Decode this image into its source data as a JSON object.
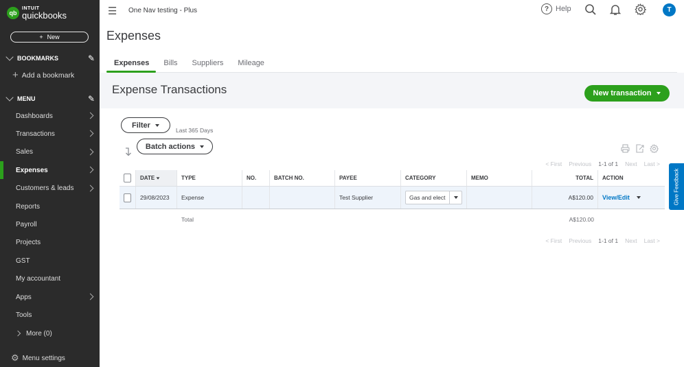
{
  "sidebar": {
    "logo": {
      "mark": "qb",
      "brand_top": "INTUIT",
      "brand_name": "quickbooks"
    },
    "new_button": {
      "icon": "plus-icon",
      "label": "New"
    },
    "bookmarks": {
      "title": "BOOKMARKS",
      "add_label": "Add a bookmark"
    },
    "menu": {
      "title": "MENU",
      "items": [
        {
          "label": "Dashboards",
          "has_arrow": true,
          "active": false
        },
        {
          "label": "Transactions",
          "has_arrow": true,
          "active": false
        },
        {
          "label": "Sales",
          "has_arrow": true,
          "active": false
        },
        {
          "label": "Expenses",
          "has_arrow": true,
          "active": true
        },
        {
          "label": "Customers & leads",
          "has_arrow": true,
          "active": false
        },
        {
          "label": "Reports",
          "has_arrow": false,
          "active": false
        },
        {
          "label": "Payroll",
          "has_arrow": false,
          "active": false
        },
        {
          "label": "Projects",
          "has_arrow": false,
          "active": false
        },
        {
          "label": "GST",
          "has_arrow": false,
          "active": false
        },
        {
          "label": "My accountant",
          "has_arrow": false,
          "active": false
        },
        {
          "label": "Apps",
          "has_arrow": true,
          "active": false
        },
        {
          "label": "Tools",
          "has_arrow": false,
          "active": false
        }
      ],
      "more_label": "More (0)"
    },
    "menu_settings_label": "Menu settings"
  },
  "topbar": {
    "company": "One Nav testing - Plus",
    "help_label": "Help",
    "avatar_initial": "T"
  },
  "page": {
    "title": "Expenses",
    "tabs": [
      {
        "label": "Expenses",
        "active": true
      },
      {
        "label": "Bills",
        "active": false
      },
      {
        "label": "Suppliers",
        "active": false
      },
      {
        "label": "Mileage",
        "active": false
      }
    ],
    "section_title": "Expense Transactions",
    "new_transaction_label": "New transaction",
    "filter_label": "Filter",
    "filter_range": "Last 365 Days",
    "batch_actions_label": "Batch actions"
  },
  "pager": {
    "first": "< First",
    "previous": "Previous",
    "range": "1-1 of 1",
    "next": "Next",
    "last": "Last >"
  },
  "table": {
    "columns": [
      "DATE",
      "TYPE",
      "NO.",
      "BATCH NO.",
      "PAYEE",
      "CATEGORY",
      "MEMO",
      "TOTAL",
      "ACTION"
    ],
    "rows": [
      {
        "date": "29/08/2023",
        "type": "Expense",
        "no": "",
        "batch_no": "",
        "payee": "Test Supplier",
        "category": "Gas and elect",
        "memo": "",
        "total": "A$120.00",
        "action": "View/Edit"
      }
    ],
    "total_label": "Total",
    "total_value": "A$120.00"
  },
  "feedback_label": "Give Feedback",
  "colors": {
    "brand_green": "#2ca01c",
    "link_blue": "#0077c5",
    "sidebar_bg": "#2b2b2b"
  }
}
